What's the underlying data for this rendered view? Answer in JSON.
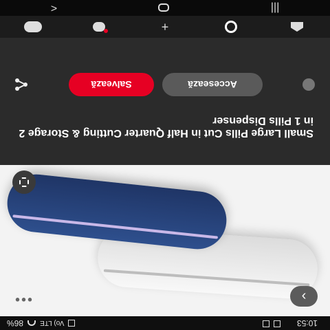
{
  "status_bar": {
    "time": "10:53",
    "battery": "86%",
    "signal": "Vo) LTE"
  },
  "pin": {
    "title": "Small Large Pills Cut in Half Quarter Cutting & Storage 2 in 1 Pills Dispenser",
    "visit_label": "Accesează",
    "save_label": "Salvează"
  },
  "image": {
    "more_label": "•••",
    "next_glyph": "›"
  },
  "bottom_nav": {
    "items": [
      "home",
      "search",
      "create",
      "messages",
      "profile"
    ],
    "create_glyph": "+"
  },
  "system_nav": {
    "recent_glyph": "|||",
    "back_glyph": "<"
  },
  "colors": {
    "save": "#e60023",
    "panel": "#2b2b2b"
  }
}
